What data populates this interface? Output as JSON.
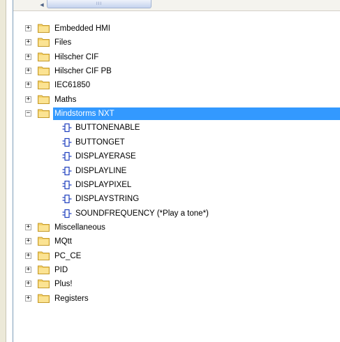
{
  "scrollbar": {
    "grip": "III"
  },
  "tree": {
    "folders_before": [
      {
        "label": "Embedded HMI"
      },
      {
        "label": "Files"
      },
      {
        "label": "Hilscher CIF"
      },
      {
        "label": "Hilscher CIF PB"
      },
      {
        "label": "IEC61850"
      },
      {
        "label": "Maths"
      }
    ],
    "expanded_folder": {
      "label": "Mindstorms NXT",
      "children": [
        {
          "label": "BUTTONENABLE"
        },
        {
          "label": "BUTTONGET"
        },
        {
          "label": "DISPLAYERASE"
        },
        {
          "label": "DISPLAYLINE"
        },
        {
          "label": "DISPLAYPIXEL"
        },
        {
          "label": "DISPLAYSTRING"
        },
        {
          "label": "SOUNDFREQUENCY (*Play a tone*)"
        }
      ]
    },
    "folders_after": [
      {
        "label": "Miscellaneous"
      },
      {
        "label": "MQtt"
      },
      {
        "label": "PC_CE"
      },
      {
        "label": "PID"
      },
      {
        "label": "Plus!"
      },
      {
        "label": "Registers"
      }
    ],
    "expander_collapsed": "+",
    "expander_expanded": "−",
    "colors": {
      "selection": "#3399ff",
      "folder_fill": "#f5d26a",
      "block_icon": "#1f3fbf"
    }
  }
}
